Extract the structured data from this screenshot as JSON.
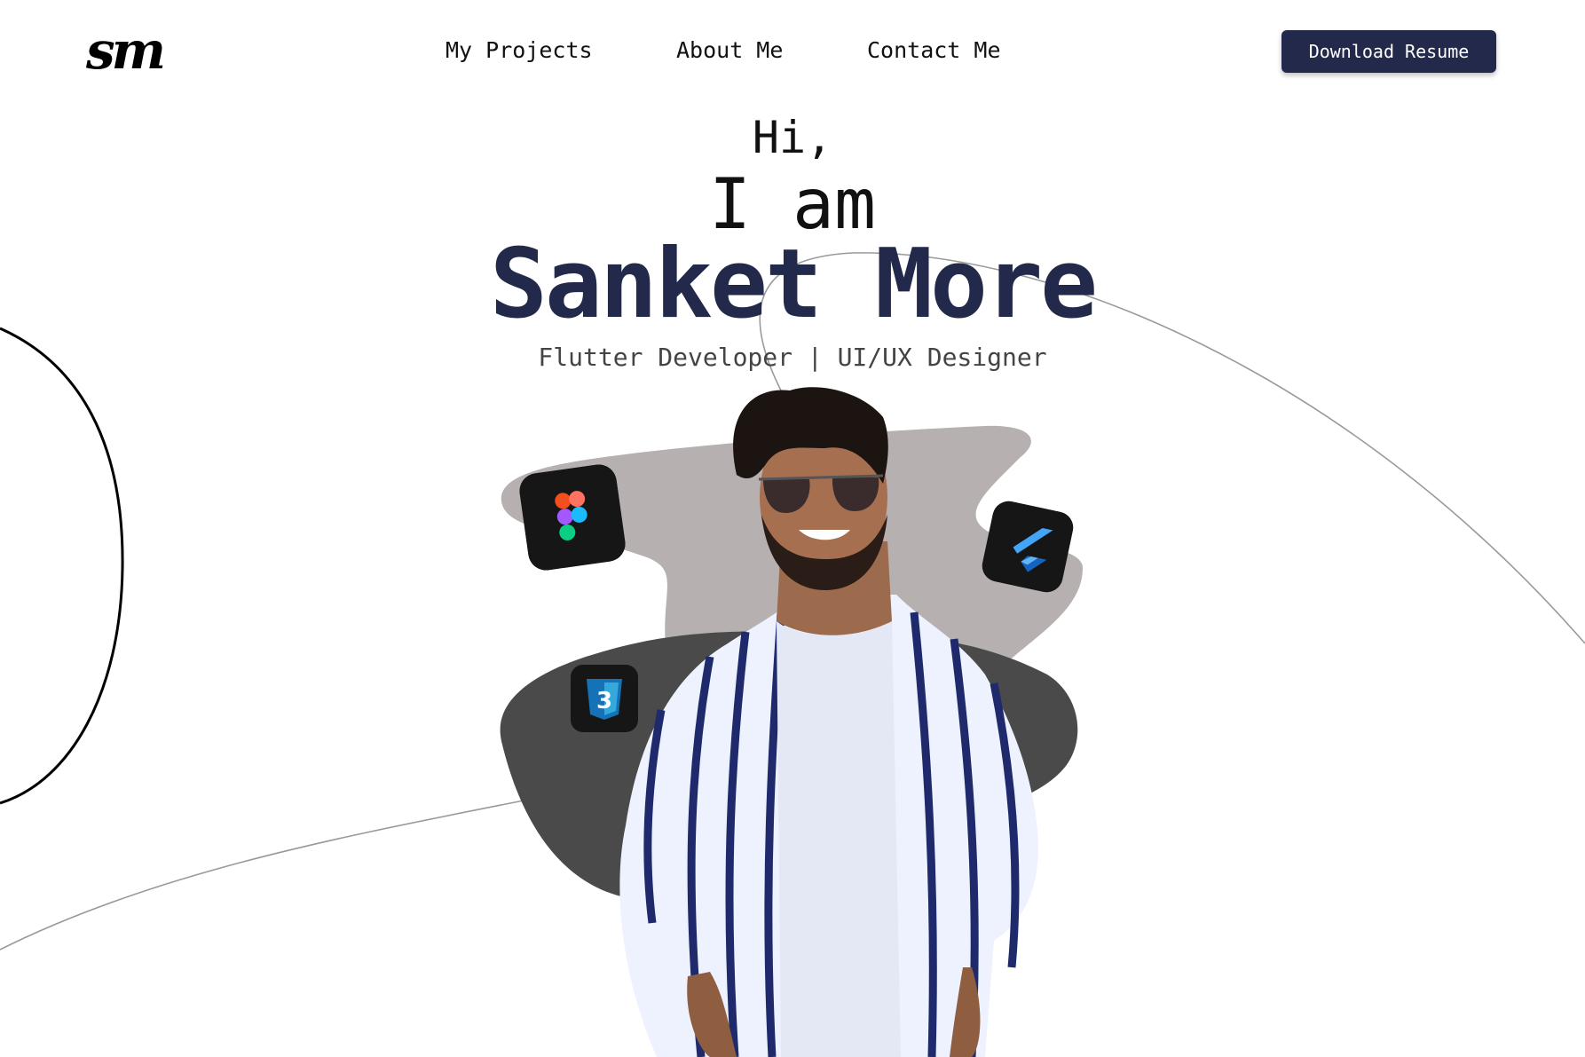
{
  "header": {
    "logo_text": "sm",
    "nav": [
      {
        "label": "My Projects"
      },
      {
        "label": "About Me"
      },
      {
        "label": "Contact Me"
      }
    ],
    "resume_button": "Download Resume"
  },
  "hero": {
    "greeting": "Hi,",
    "intro": "I am",
    "name": "Sanket More",
    "role": "Flutter Developer | UI/UX Designer"
  },
  "icons": [
    "figma-icon",
    "flutter-icon",
    "css3-icon"
  ],
  "colors": {
    "accent": "#22294a",
    "blob_light": "#b6b0b0",
    "blob_dark": "#4a4a4a",
    "shirt": "#eef2ff",
    "stripe": "#1e2a6b"
  }
}
